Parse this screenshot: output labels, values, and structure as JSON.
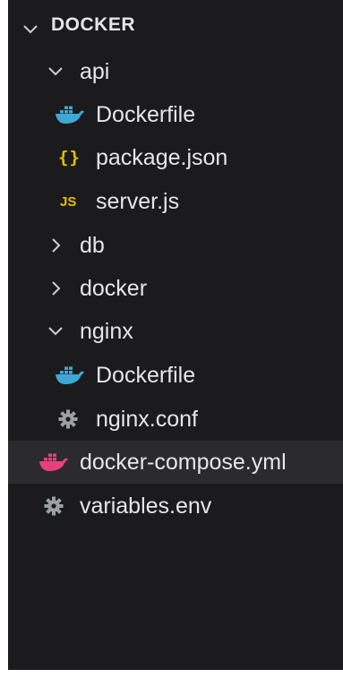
{
  "explorer": {
    "title": "DOCKER",
    "items": [
      {
        "label": "api",
        "kind": "folder",
        "state": "expanded",
        "icon": "chevron-down-icon"
      },
      {
        "label": "Dockerfile",
        "kind": "file",
        "icon": "docker-icon",
        "color": "#3fa7d6"
      },
      {
        "label": "package.json",
        "kind": "file",
        "icon": "json-icon",
        "glyph": "{}",
        "color": "#e5c100"
      },
      {
        "label": "server.js",
        "kind": "file",
        "icon": "javascript-icon",
        "glyph": "JS",
        "color": "#e5c100"
      },
      {
        "label": "db",
        "kind": "folder",
        "state": "collapsed",
        "icon": "chevron-right-icon"
      },
      {
        "label": "docker",
        "kind": "folder",
        "state": "collapsed",
        "icon": "chevron-right-icon"
      },
      {
        "label": "nginx",
        "kind": "folder",
        "state": "expanded",
        "icon": "chevron-down-icon"
      },
      {
        "label": "Dockerfile",
        "kind": "file",
        "icon": "docker-icon",
        "color": "#3fa7d6"
      },
      {
        "label": "nginx.conf",
        "kind": "file",
        "icon": "gear-icon",
        "color": "#9aa0a6"
      },
      {
        "label": "docker-compose.yml",
        "kind": "file",
        "icon": "docker-icon",
        "color": "#e8417a",
        "selected": true
      },
      {
        "label": "variables.env",
        "kind": "file",
        "icon": "gear-icon",
        "color": "#9aa0a6"
      }
    ]
  },
  "colors": {
    "background": "#1b1b1d",
    "selected_row": "#2b2b2e",
    "text": "#e6e6e6"
  }
}
